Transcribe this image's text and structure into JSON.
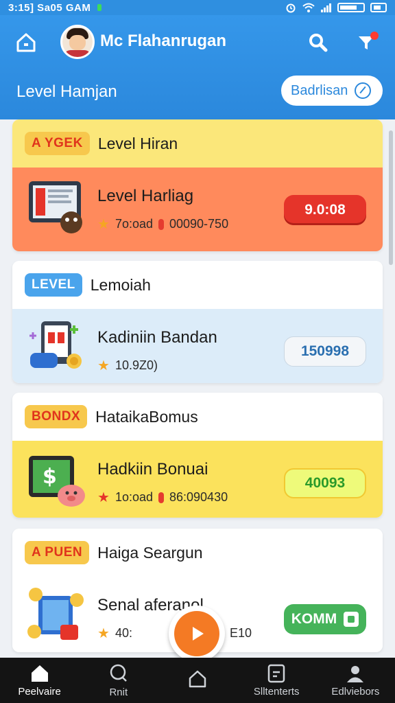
{
  "status_bar": {
    "time": "3:15] Sa05 GAM"
  },
  "header": {
    "username": "Mc Flahanrugan",
    "page_title": "Level Hamjan",
    "pill_label": "Badrlisan",
    "icons": [
      "home-icon",
      "search-icon",
      "filter-icon"
    ]
  },
  "cards": [
    {
      "tag": "A YGEK",
      "head_title": "Level Hiran",
      "body_title": "Level Harliag",
      "meta_left": "7o:oad",
      "meta_right": "00090-750",
      "value": "9.0:08",
      "colors": {
        "head": "#fbe77a",
        "body": "#ff8a5c",
        "button": "#e5342a"
      }
    },
    {
      "tag": "LEVEL",
      "head_title": "Lemoiah",
      "body_title": "Kadiniin Bandan",
      "meta_left": "10.9Z0)",
      "meta_right": "",
      "value": "150998",
      "colors": {
        "head": "#ffffff",
        "body": "#dcecf9",
        "button": "#f3f6f9"
      }
    },
    {
      "tag": "BONDX",
      "head_title": "HataikaBomus",
      "body_title": "Hadkiin Bonuai",
      "meta_left": "1o:oad",
      "meta_right": "86:090430",
      "value": "40093",
      "colors": {
        "head": "#ffffff",
        "body": "#fbe25c",
        "button": "#eefa7a"
      }
    },
    {
      "tag": "A PUEN",
      "head_title": "Haiga Seargun",
      "body_title": "Senal aferanol",
      "meta_left": "40:",
      "meta_right": "E10",
      "value": "KOMM",
      "colors": {
        "head": "#ffffff",
        "body": "#ffffff",
        "button": "#45b35a"
      }
    }
  ],
  "bottom_nav": [
    {
      "label": "Peelvaire",
      "icon": "home-icon"
    },
    {
      "label": "Rnit",
      "icon": "search-icon"
    },
    {
      "label": "",
      "icon": "house-outline-icon"
    },
    {
      "label": "Slltenterts",
      "icon": "document-icon"
    },
    {
      "label": "Edlviebors",
      "icon": "profile-icon"
    }
  ],
  "fab": {
    "icon": "play-icon"
  }
}
